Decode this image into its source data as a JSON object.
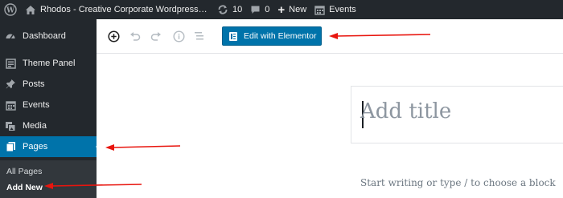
{
  "adminbar": {
    "site_title": "Rhodos - Creative Corporate Wordpress Th...",
    "updates_count": "10",
    "comments_count": "0",
    "new_label": "New",
    "events_label": "Events"
  },
  "sidebar": {
    "dashboard": "Dashboard",
    "theme_panel": "Theme Panel",
    "posts": "Posts",
    "events": "Events",
    "media": "Media",
    "pages": "Pages",
    "submenu": {
      "all_pages": "All Pages",
      "add_new": "Add New"
    }
  },
  "editor": {
    "elementor_button": "Edit with Elementor",
    "title_placeholder": "Add title",
    "block_placeholder": "Start writing or type / to choose a block"
  },
  "colors": {
    "admin_dark": "#23282d",
    "submenu_bg": "#32373c",
    "accent_blue": "#0073aa",
    "annotation_red": "#e8150e"
  },
  "icons": {
    "adminbar": [
      "wordpress-icon",
      "home-icon",
      "updates-icon",
      "comment-icon",
      "plus-icon",
      "calendar-icon"
    ],
    "sidebar": [
      "dashboard-icon",
      "theme-panel-icon",
      "pin-icon",
      "calendar-icon",
      "media-icon",
      "pages-icon"
    ],
    "toolbar": [
      "add-block-icon",
      "undo-icon",
      "redo-icon",
      "info-icon",
      "block-navigation-icon",
      "elementor-icon"
    ]
  }
}
